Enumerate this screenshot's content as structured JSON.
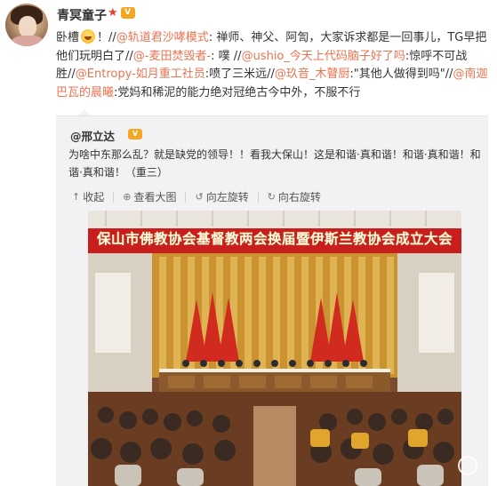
{
  "post": {
    "username": "青冥童子",
    "text_parts": {
      "p1": "卧槽",
      "p2": "！",
      "m1": "@轨道君沙哮模式",
      "p3": ": 禅师、神父、阿訇，大家诉求都是一回事儿，TG早把他们玩明白了//",
      "m2": "@-麦田焚毁者-",
      "p4": ": 噗 //",
      "m3": "@ushio_今天上代码脑子好了吗",
      "p5": ":惊呼不可战胜//",
      "m4": "@Entropy-如月重工社员",
      "p6": ":喷了三米远//",
      "m5": "@玖音_木瞽厨",
      "p7": ":\"其他人做得到吗\"//",
      "m6": "@南迦巴瓦的晨曦",
      "p8": ":党妈和稀泥的能力绝对冠绝古今中外，不服不行"
    }
  },
  "repost": {
    "author": "@邢立达",
    "text": "为啥中东那么乱？就是缺党的领导！！看我大保山！这是和谐·真和谐！和谐·真和谐！和谐·真和谐！（重三）",
    "toolbar": {
      "collapse": "收起",
      "view_large": "查看大图",
      "rotate_left": "向左旋转",
      "rotate_right": "向右旋转"
    },
    "photo_banner": "保山市佛教协会基督教两会换届暨伊斯兰教协会成立大会"
  },
  "colors": {
    "mention": "#eb7350",
    "banner": "#c81e1e",
    "curtain": "#d4a23a",
    "flags": "#d12a1e"
  }
}
